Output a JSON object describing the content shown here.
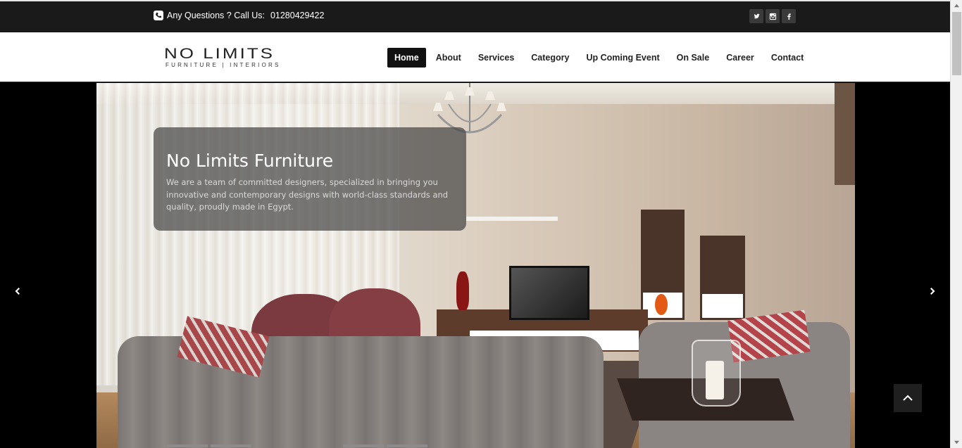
{
  "topbar": {
    "phone_label": "Any Questions ? Call Us:",
    "phone_number": "01280429422",
    "socials": [
      "twitter-icon",
      "instagram-icon",
      "facebook-icon"
    ]
  },
  "logo": {
    "main": "NO LIMITS",
    "sub": "FURNITURE  |  INTERIORS"
  },
  "nav": {
    "items": [
      "Home",
      "About",
      "Services",
      "Category",
      "Up Coming Event",
      "On Sale",
      "Career",
      "Contact"
    ],
    "active": "Home"
  },
  "slider": {
    "caption_title": "No Limits Furniture",
    "caption_text": "We are a team of committed designers, specialized in bringing you innovative and contemporary designs with world-class standards and quality, proudly made in Egypt."
  },
  "colors": {
    "topbar_bg": "#1a1a1a",
    "nav_active_bg": "#111111",
    "accent_text": "#222222"
  }
}
